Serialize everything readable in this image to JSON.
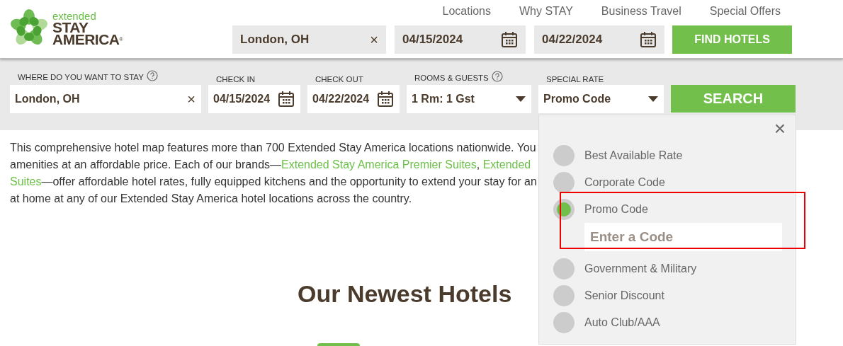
{
  "logo": {
    "small": "extended",
    "line1": "STAY",
    "line2": "AMERICA",
    "mark": "®"
  },
  "nav": [
    "Locations",
    "Why STAY",
    "Business Travel",
    "Special Offers"
  ],
  "header_search": {
    "location": "London, OH",
    "clear": "×",
    "check_in": "04/15/2024",
    "check_out": "04/22/2024",
    "button": "FIND HOTELS"
  },
  "search_bar": {
    "where_label": "WHERE DO YOU WANT TO STAY",
    "where": "London, OH",
    "clear": "×",
    "check_in_label": "CHECK IN",
    "check_in": "04/15/2024",
    "check_out_label": "CHECK OUT",
    "check_out": "04/22/2024",
    "rooms_label": "ROOMS & GUESTS",
    "rooms": "1 Rm: 1 Gst",
    "rate_label": "SPECIAL RATE",
    "rate": "Promo Code",
    "button": "SEARCH"
  },
  "rate_menu": {
    "close": "×",
    "options": [
      {
        "label": "Best Available Rate",
        "selected": false
      },
      {
        "label": "Corporate Code",
        "selected": false
      },
      {
        "label": "Promo Code",
        "selected": true,
        "highlighted": true,
        "code_field": {
          "placeholder": "Enter a Code"
        }
      },
      {
        "label": "Government & Military",
        "selected": false
      },
      {
        "label": "Senior Discount",
        "selected": false
      },
      {
        "label": "Auto Club/AAA",
        "selected": false
      }
    ]
  },
  "intro": [
    [
      {
        "text": "This comprehensive hotel map features more than 700 Extended Stay America locations nationwide. You",
        "kind": "text"
      }
    ],
    [
      {
        "text": "amenities at an affordable price. Each of our brands—",
        "kind": "text"
      },
      {
        "text": "Extended Stay America Premier Suites",
        "kind": "link"
      },
      {
        "text": ", ",
        "kind": "text"
      },
      {
        "text": "Extended",
        "kind": "link"
      }
    ],
    [
      {
        "text": "Suites",
        "kind": "link"
      },
      {
        "text": "—offer affordable hotel rates, fully equipped kitchens and the opportunity to extend your stay for an",
        "kind": "text"
      }
    ],
    [
      {
        "text": "at home at any of our Extended Stay America hotel locations across the country.",
        "kind": "text"
      }
    ]
  ],
  "section_title": "Our Newest Hotels"
}
